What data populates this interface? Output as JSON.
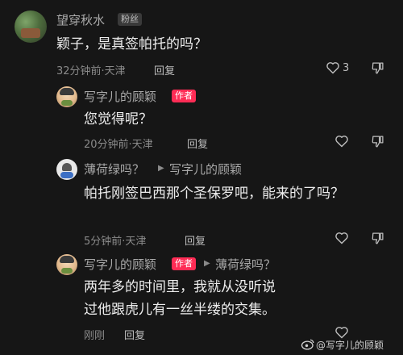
{
  "comments": [
    {
      "username": "望穿秋水",
      "badge": "粉丝",
      "text": "颖子，是真签帕托的吗？",
      "time_location": "32分钟前·天津",
      "reply_label": "回复",
      "like_count": "3"
    },
    {
      "username": "写字儿的顾颖",
      "badge": "作者",
      "text": "您觉得呢？",
      "time_location": "20分钟前·天津",
      "reply_label": "回复"
    },
    {
      "username": "薄荷绿吗？",
      "reply_to": "写字儿的顾颖",
      "text": "帕托刚签巴西那个圣保罗吧，能来的了吗？",
      "time_location": "5分钟前·天津",
      "reply_label": "回复"
    },
    {
      "username": "写字儿的顾颖",
      "badge": "作者",
      "reply_to": "薄荷绿吗？",
      "text": "两年多的时间里，我就从没听说过他跟虎儿有一丝半缕的交集。",
      "time_location": "刚刚",
      "reply_label": "回复"
    }
  ],
  "watermark": "@写字儿的顾颖",
  "icons": {
    "like": "heart-outline-icon",
    "dislike": "thumbs-down-icon",
    "reply_arrow": "triangle-right-icon",
    "watermark_logo": "weibo-logo-icon"
  }
}
